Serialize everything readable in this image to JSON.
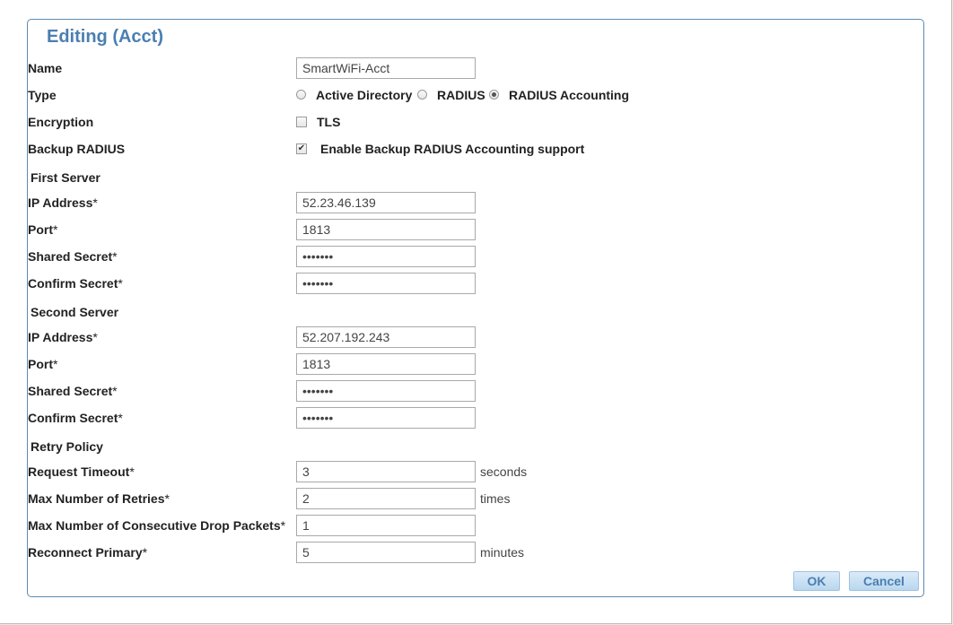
{
  "dialog": {
    "title": "Editing (Acct)"
  },
  "form": {
    "name_label": "Name",
    "name_value": "SmartWiFi-Acct",
    "type_label": "Type",
    "type_options": [
      "Active Directory",
      "RADIUS",
      "RADIUS Accounting"
    ],
    "type_selected": "RADIUS Accounting",
    "encryption_label": "Encryption",
    "encryption_option": "TLS",
    "encryption_checked": false,
    "backup_label": "Backup RADIUS",
    "backup_option": "Enable Backup RADIUS Accounting support",
    "backup_checked": true,
    "star": "*"
  },
  "first_server": {
    "heading": "First Server",
    "ip_label": "IP Address",
    "ip_value": "52.23.46.139",
    "port_label": "Port",
    "port_value": "1813",
    "secret_label": "Shared Secret",
    "secret_value": "•••••••",
    "confirm_label": "Confirm Secret",
    "confirm_value": "•••••••"
  },
  "second_server": {
    "heading": "Second Server",
    "ip_label": "IP Address",
    "ip_value": "52.207.192.243",
    "port_label": "Port",
    "port_value": "1813",
    "secret_label": "Shared Secret",
    "secret_value": "•••••••",
    "confirm_label": "Confirm Secret",
    "confirm_value": "•••••••"
  },
  "retry": {
    "heading": "Retry Policy",
    "timeout_label": "Request Timeout",
    "timeout_value": "3",
    "timeout_unit": "seconds",
    "retries_label": "Max Number of Retries",
    "retries_value": "2",
    "retries_unit": "times",
    "drop_label": "Max Number of Consecutive Drop Packets",
    "drop_value": "1",
    "reconnect_label": "Reconnect Primary",
    "reconnect_value": "5",
    "reconnect_unit": "minutes"
  },
  "buttons": {
    "ok": "OK",
    "cancel": "Cancel"
  }
}
